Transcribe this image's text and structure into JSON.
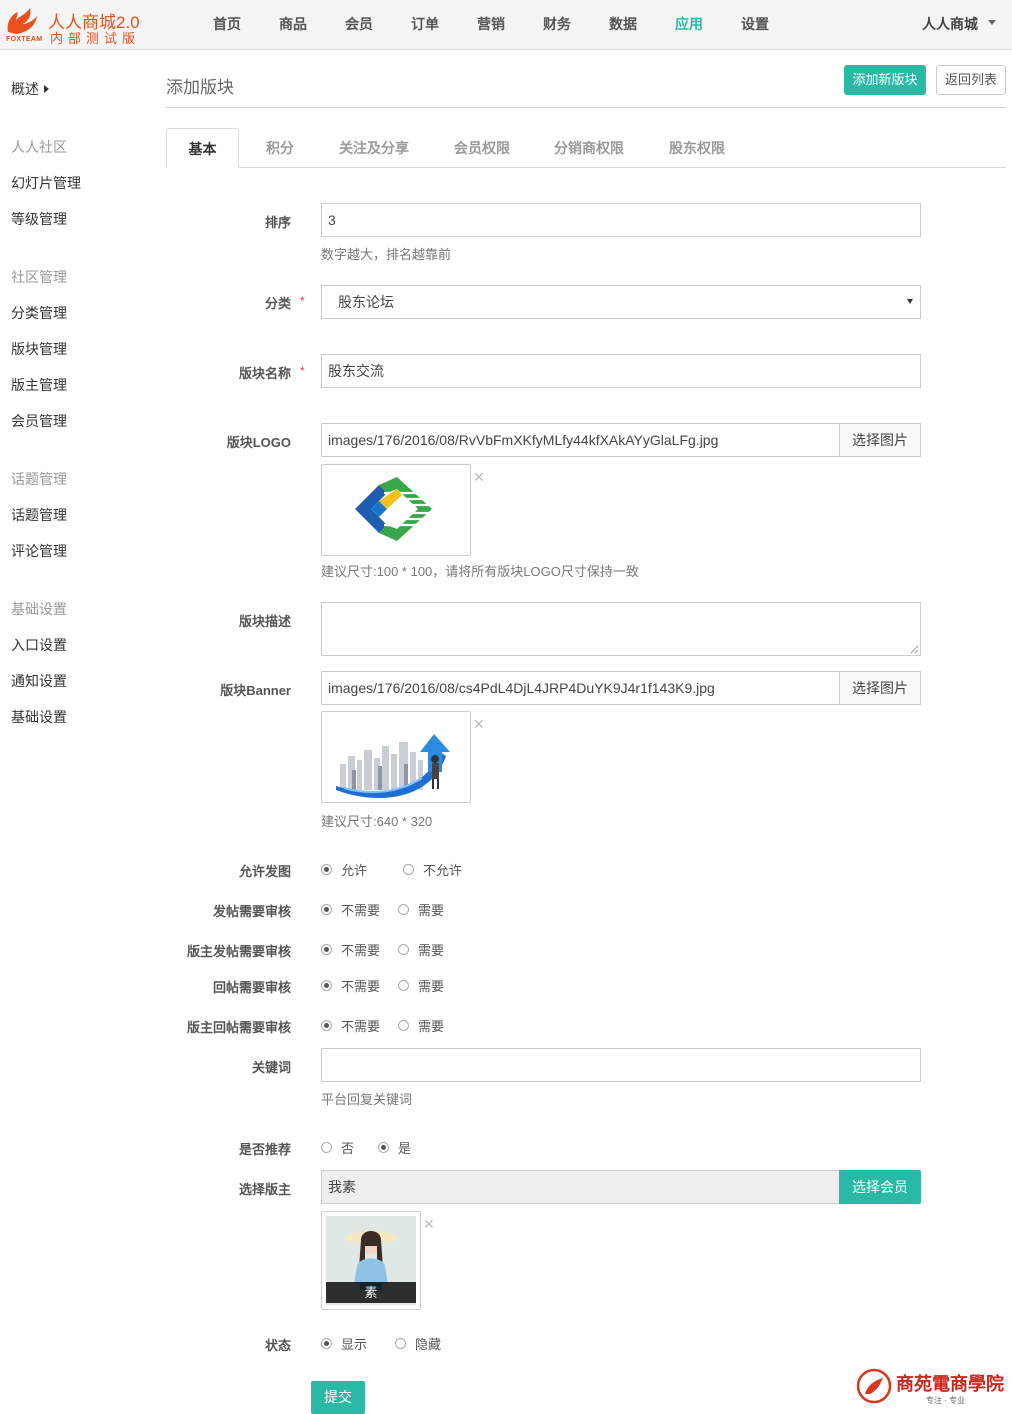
{
  "logo": {
    "brand": "人人商城2.0",
    "sub": "内部测试版",
    "mark": "FOXTEAM"
  },
  "nav": {
    "items": [
      "首页",
      "商品",
      "会员",
      "订单",
      "营销",
      "财务",
      "数据",
      "应用",
      "设置"
    ],
    "active": "应用",
    "user": "人人商城"
  },
  "sidebar": {
    "overview": "概述",
    "groups": [
      {
        "title": "人人社区",
        "items": [
          "幻灯片管理",
          "等级管理"
        ]
      },
      {
        "title": "社区管理",
        "items": [
          "分类管理",
          "版块管理",
          "版主管理",
          "会员管理"
        ]
      },
      {
        "title": "话题管理",
        "items": [
          "话题管理",
          "评论管理"
        ]
      },
      {
        "title": "基础设置",
        "items": [
          "入口设置",
          "通知设置",
          "基础设置"
        ]
      }
    ]
  },
  "header": {
    "title": "添加版块",
    "add_button": "添加新版块",
    "back_button": "返回列表"
  },
  "tabs": [
    "基本",
    "积分",
    "关注及分享",
    "会员权限",
    "分销商权限",
    "股东权限"
  ],
  "form": {
    "sort": {
      "label": "排序",
      "value": "3",
      "help": "数字越大，排名越靠前"
    },
    "category": {
      "label": "分类",
      "value": "股东论坛"
    },
    "name": {
      "label": "版块名称",
      "value": "股东交流"
    },
    "logo": {
      "label": "版块LOGO",
      "value": "images/176/2016/08/RvVbFmXKfyMLfy44kfXAkAYyGlaLFg.jpg",
      "button": "选择图片",
      "help": "建议尺寸:100 * 100，请将所有版块LOGO尺寸保持一致"
    },
    "description": {
      "label": "版块描述",
      "value": ""
    },
    "banner": {
      "label": "版块Banner",
      "value": "images/176/2016/08/cs4PdL4DjL4JRP4DuYK9J4r1f143K9.jpg",
      "button": "选择图片",
      "help": "建议尺寸:640 * 320"
    },
    "allow_image": {
      "label": "允许发图",
      "options": [
        "允许",
        "不允许"
      ],
      "selected": 0
    },
    "post_review": {
      "label": "发帖需要审核",
      "options": [
        "不需要",
        "需要"
      ],
      "selected": 0
    },
    "mod_post_review": {
      "label": "版主发帖需要审核",
      "options": [
        "不需要",
        "需要"
      ],
      "selected": 0
    },
    "reply_review": {
      "label": "回帖需要审核",
      "options": [
        "不需要",
        "需要"
      ],
      "selected": 0
    },
    "mod_reply_review": {
      "label": "版主回帖需要审核",
      "options": [
        "不需要",
        "需要"
      ],
      "selected": 0
    },
    "keyword": {
      "label": "关键词",
      "value": "",
      "help": "平台回复关键词"
    },
    "recommend": {
      "label": "是否推荐",
      "options": [
        "否",
        "是"
      ],
      "selected": 1
    },
    "moderator": {
      "label": "选择版主",
      "value": "我素",
      "button": "选择会员",
      "caption": "素"
    },
    "status": {
      "label": "状态",
      "options": [
        "显示",
        "隐藏"
      ],
      "selected": 0
    },
    "submit": "提交"
  },
  "watermark": {
    "title": "商苑電商學院",
    "tagline": "专注 · 专业"
  },
  "colors": {
    "accent": "#2ab9a5",
    "brand": "#e8501e",
    "required": "#e4393c"
  }
}
